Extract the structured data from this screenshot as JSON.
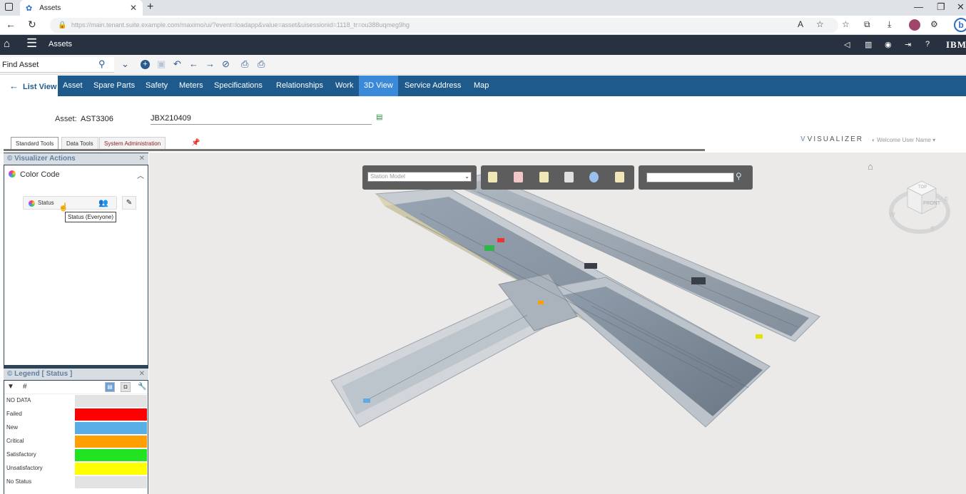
{
  "browser": {
    "tab_title": "Assets",
    "tab_icon": "maximo-app-icon",
    "new_tab": "+",
    "url_text": "https://main.tenant.suite.example.com/maximo/ui/?event=loadapp&value=asset&uisessionid=1118_tr=ou388uqmeg9hg",
    "window_buttons": [
      "—",
      "❐",
      "✕"
    ]
  },
  "app_header": {
    "title": "Assets",
    "brand": "IBM"
  },
  "toolbar": {
    "find_placeholder": "Find Asset"
  },
  "tabs": {
    "list_view": "List View",
    "items": [
      "Asset",
      "Spare Parts",
      "Safety",
      "Meters",
      "Specifications",
      "Relationships",
      "Work",
      "3D View",
      "Service Address",
      "Map"
    ],
    "active": "3D View"
  },
  "asset": {
    "label": "Asset:",
    "value": "AST3306",
    "description": "JBX210409"
  },
  "visualizer": {
    "tool_tabs": [
      "Standard Tools",
      "Data Tools",
      "System Administration"
    ],
    "active_tool_tab": "Standard Tools",
    "logo": "VISUALIZER",
    "welcome": "Welcome User Name"
  },
  "actions_panel": {
    "title": "Visualizer Actions",
    "section": "Color Code",
    "status_button": "Status",
    "tooltip": "Status (Everyone)"
  },
  "legend_panel": {
    "title": "Legend [ Status ]",
    "items": [
      {
        "label": "NO DATA",
        "color": "#e3e3e3"
      },
      {
        "label": "Failed",
        "color": "#ff0000"
      },
      {
        "label": "New",
        "color": "#59aee6"
      },
      {
        "label": "Critical",
        "color": "#ffa000"
      },
      {
        "label": "Satisfactory",
        "color": "#22e322"
      },
      {
        "label": "Unsatisfactory",
        "color": "#ffff00"
      },
      {
        "label": "No Status",
        "color": "#e3e3e3"
      }
    ]
  },
  "viewport": {
    "model_selector": "Station Model",
    "search_value": "",
    "navcube": {
      "top": "TOP",
      "front": "FRONT",
      "west": "W",
      "south": "S",
      "east": "E"
    }
  },
  "colors": {
    "header_bg": "#27313f",
    "tabs_bg": "#1e5a8c",
    "active_tab": "#3b8ad9",
    "panel_header": "#d8dde3"
  }
}
